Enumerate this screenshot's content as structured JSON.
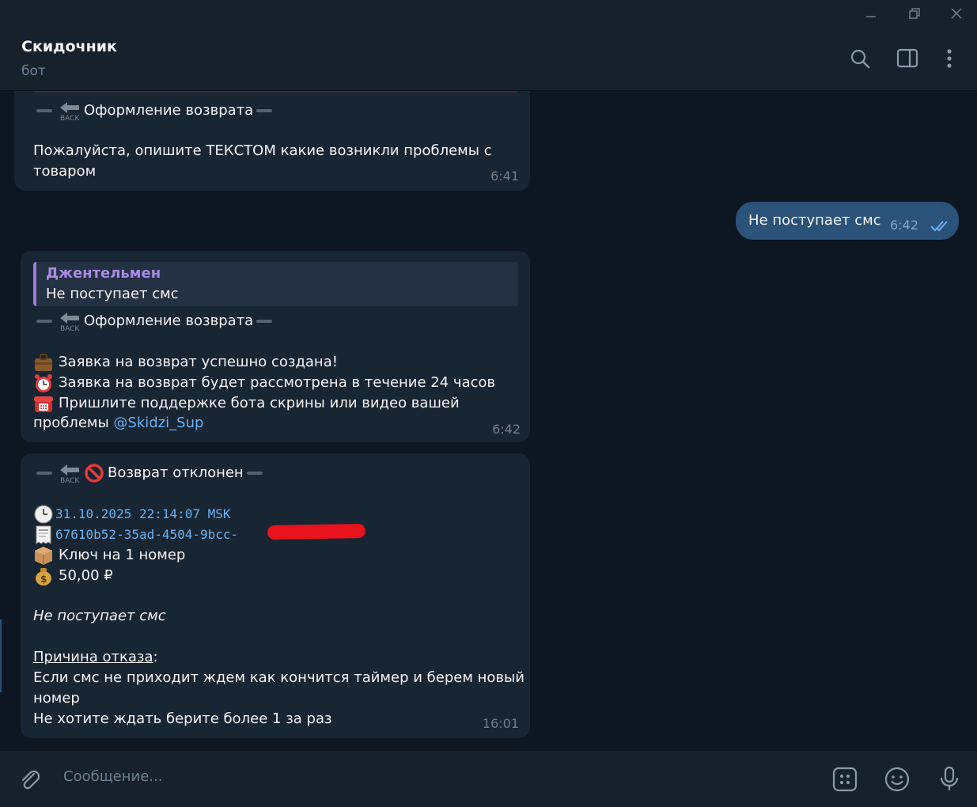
{
  "window": {
    "minimize_icon": "minimize-icon",
    "restore_icon": "restore-icon",
    "close_icon": "close-icon"
  },
  "header": {
    "title": "Скидочник",
    "subtitle": "бот"
  },
  "messages": {
    "m1": {
      "header_text": "Оформление возврата",
      "line1": "Пожалуйста, опишите ТЕКСТОМ какие возникли проблемы с",
      "line2": "товаром",
      "time": "6:41"
    },
    "m2": {
      "text": "Не поступает смс",
      "time": "6:42"
    },
    "m3": {
      "quote_name": "Джентельмен",
      "quote_text": "Не поступает смс",
      "header_text": "Оформление возврата",
      "line1": "Заявка на возврат успешно создана!",
      "line2": "Заявка на возврат будет рассмотрена в течение 24 часов",
      "line3": "Пришлите поддержке бота скрины или видео вашей",
      "line4": "проблемы",
      "mention": "@Skidzi_Sup",
      "time": "6:42"
    },
    "m4": {
      "header_text": "Возврат отклонен",
      "date": "31.10.2025 22:14:07 MSK",
      "order_id": "67610b52-35ad-4504-9bcc-",
      "product": "Ключ на 1 номер",
      "price": "50,00 ₽",
      "comment": "Не поступает смс",
      "reason_label": "Причина отказа",
      "reason_colon": ":",
      "reason1": "Если смс не приходит ждем как кончится таймер и берем новый",
      "reason2": "номер",
      "reason3": "Не хотите ждать берите более 1 за раз",
      "time": "16:01"
    }
  },
  "composer": {
    "placeholder": "Сообщение..."
  },
  "colors": {
    "accent": "#6ab3f3",
    "bubble_in": "#182533",
    "bubble_out": "#2b5278",
    "quote_name": "#a98ae6"
  }
}
